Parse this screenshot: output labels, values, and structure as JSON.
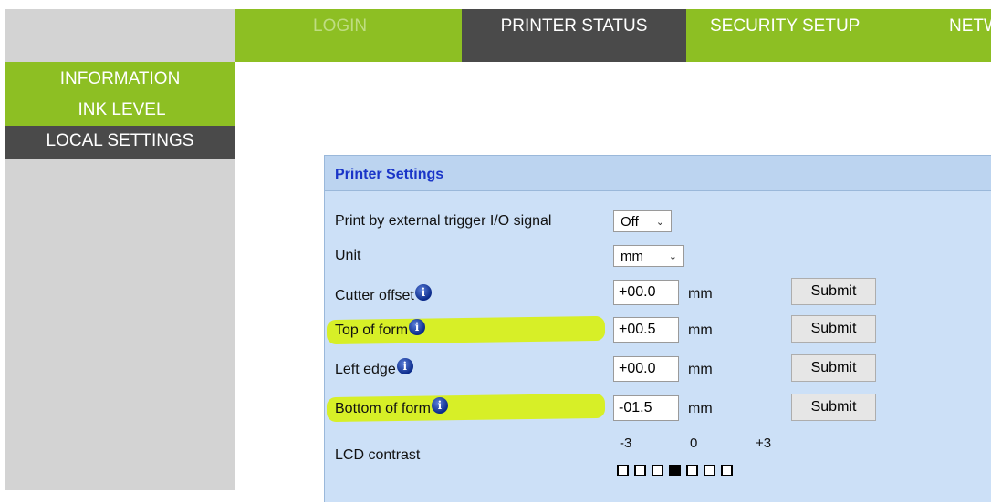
{
  "topnav": {
    "tabs": [
      {
        "label": "LOGIN",
        "state": "disabled"
      },
      {
        "label": "PRINTER STATUS",
        "state": "active"
      },
      {
        "label": "SECURITY SETUP",
        "state": "normal"
      },
      {
        "label": "NETW",
        "state": "normal"
      }
    ]
  },
  "sidebar": {
    "items": [
      {
        "label": "INFORMATION",
        "active": false
      },
      {
        "label": "INK LEVEL",
        "active": false
      },
      {
        "label": "LOCAL SETTINGS",
        "active": true
      }
    ]
  },
  "panel": {
    "title": "Printer Settings",
    "trigger": {
      "label": "Print by external trigger I/O signal",
      "value": "Off"
    },
    "unit": {
      "label": "Unit",
      "value": "mm"
    },
    "rows": [
      {
        "label": "Cutter offset",
        "value": "+00.0",
        "unit": "mm",
        "button": "Submit",
        "highlighted": false
      },
      {
        "label": "Top of form",
        "value": "+00.5",
        "unit": "mm",
        "button": "Submit",
        "highlighted": true
      },
      {
        "label": "Left edge",
        "value": "+00.0",
        "unit": "mm",
        "button": "Submit",
        "highlighted": false
      },
      {
        "label": "Bottom of form",
        "value": "-01.5",
        "unit": "mm",
        "button": "Submit",
        "highlighted": true
      }
    ],
    "lcd": {
      "label": "LCD contrast",
      "min_label": "-3",
      "mid_label": "0",
      "max_label": "+3",
      "levels": 7,
      "selected_index": 3
    }
  },
  "info_icon_glyph": "i",
  "colors": {
    "nav_green": "#8dbf23",
    "active_dark": "#4a4a4a",
    "panel_bg": "#cce0f7",
    "title_blue": "#1a35c8",
    "highlight": "#d7ef1b"
  }
}
